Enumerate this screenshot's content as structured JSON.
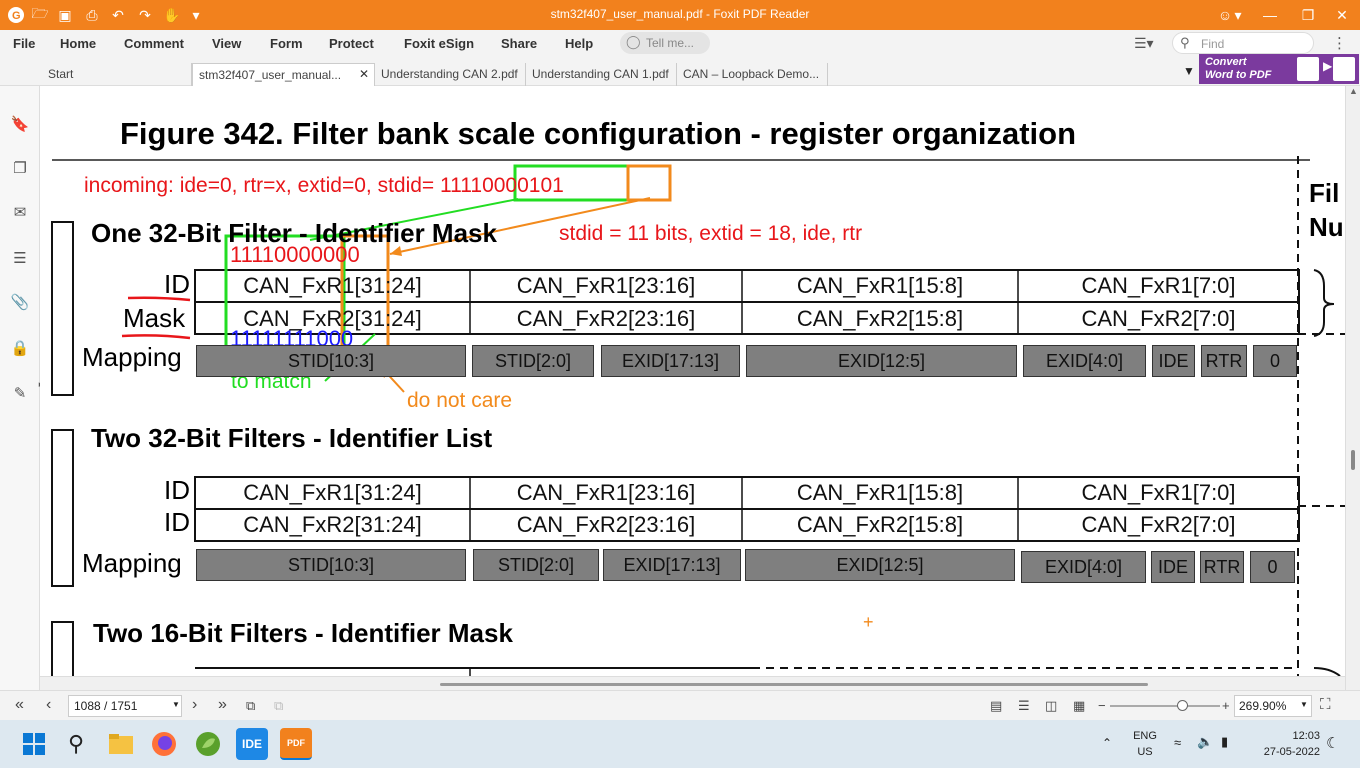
{
  "window": {
    "title": "stm32f407_user_manual.pdf - Foxit PDF Reader",
    "accent": "#f2811d"
  },
  "menu": [
    "File",
    "Home",
    "Comment",
    "View",
    "Form",
    "Protect",
    "Foxit eSign",
    "Share",
    "Help"
  ],
  "tell_me": "Tell me...",
  "find_placeholder": "Find",
  "tabs": [
    {
      "label": "Start"
    },
    {
      "label": "stm32f407_user_manual..."
    },
    {
      "label": "Understanding CAN 2.pdf"
    },
    {
      "label": "Understanding CAN 1.pdf"
    },
    {
      "label": "CAN – Loopback Demo..."
    }
  ],
  "convert_banner": {
    "line1": "Convert",
    "line2": "Word to PDF"
  },
  "document": {
    "figure_title": "Figure 342. Filter bank scale configuration - register organization",
    "side_heading": "Fil Nu",
    "annotations": {
      "incoming_prefix": "incoming: ide=0, rtr=x, extid=0, stdid= ",
      "incoming_green": "11110000",
      "incoming_orange": "101",
      "stdid_note": "stdid = 11 bits, extid = 18, ide, rtr",
      "id_value_red": "11110000",
      "id_value_orange": "000",
      "mask_value_blue": "11111111000",
      "to_match": "to match",
      "do_not_care": "do not care",
      "crosshair": "+",
      "colors": {
        "red": "#e8161a",
        "green": "#22dd22",
        "orange": "#f28a1c",
        "blue": "#1a1aff"
      }
    },
    "section1": {
      "heading": "One 32-Bit Filter - Identifier Mask",
      "row_labels": [
        "ID",
        "Mask",
        "Mapping"
      ],
      "row1": [
        "CAN_FxR1[31:24]",
        "CAN_FxR1[23:16]",
        "CAN_FxR1[15:8]",
        "CAN_FxR1[7:0]"
      ],
      "row2": [
        "CAN_FxR2[31:24]",
        "CAN_FxR2[23:16]",
        "CAN_FxR2[15:8]",
        "CAN_FxR2[7:0]"
      ],
      "mapping": [
        "STID[10:3]",
        "STID[2:0]",
        "EXID[17:13]",
        "EXID[12:5]",
        "EXID[4:0]",
        "IDE",
        "RTR",
        "0"
      ]
    },
    "section2": {
      "heading": "Two 32-Bit Filters - Identifier List",
      "row_labels": [
        "ID",
        "ID",
        "Mapping"
      ],
      "row1": [
        "CAN_FxR1[31:24]",
        "CAN_FxR1[23:16]",
        "CAN_FxR1[15:8]",
        "CAN_FxR1[7:0]"
      ],
      "row2": [
        "CAN_FxR2[31:24]",
        "CAN_FxR2[23:16]",
        "CAN_FxR2[15:8]",
        "CAN_FxR2[7:0]"
      ],
      "mapping": [
        "STID[10:3]",
        "STID[2:0]",
        "EXID[17:13]",
        "EXID[12:5]",
        "EXID[4:0]",
        "IDE",
        "RTR",
        "0"
      ]
    },
    "section3": {
      "heading": "Two 16-Bit Filters - Identifier Mask"
    }
  },
  "status": {
    "page": "1088 / 1751",
    "zoom": "269.90%"
  },
  "taskbar": {
    "lang_top": "ENG",
    "lang_bottom": "US",
    "time": "12:03",
    "date": "27-05-2022",
    "ide_label": "IDE",
    "pdf_label": "PDF"
  }
}
